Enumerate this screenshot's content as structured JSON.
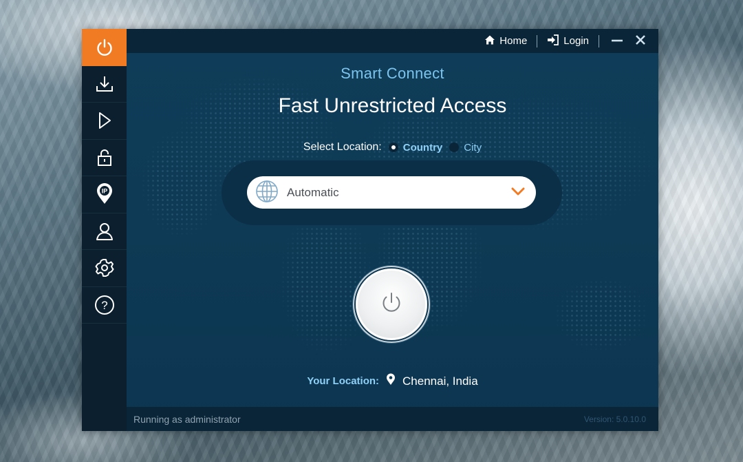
{
  "titlebar": {
    "home_label": "Home",
    "login_label": "Login"
  },
  "sidebar": {
    "items": [
      {
        "name": "power",
        "icon": "power-icon",
        "active": true
      },
      {
        "name": "download",
        "icon": "download-icon"
      },
      {
        "name": "play",
        "icon": "play-icon"
      },
      {
        "name": "lock",
        "icon": "lock-icon"
      },
      {
        "name": "ip",
        "icon": "ip-location-icon",
        "text": "IP"
      },
      {
        "name": "account",
        "icon": "user-icon"
      },
      {
        "name": "settings",
        "icon": "gear-icon"
      },
      {
        "name": "help",
        "icon": "help-icon",
        "text": "?"
      }
    ]
  },
  "main": {
    "subtitle": "Smart Connect",
    "headline": "Fast Unrestricted Access",
    "select_location_label": "Select Location:",
    "location_modes": [
      {
        "label": "Country",
        "selected": true
      },
      {
        "label": "City",
        "selected": false
      }
    ],
    "location_dropdown": {
      "value": "Automatic"
    },
    "your_location_label": "Your Location:",
    "your_location_value": "Chennai, India"
  },
  "status": {
    "left": "Running as administrator",
    "version": "Version:  5.0.10.0"
  },
  "colors": {
    "accent": "#f07b23",
    "highlight_text": "#8fd0f6",
    "panel": "#0f3c58"
  }
}
